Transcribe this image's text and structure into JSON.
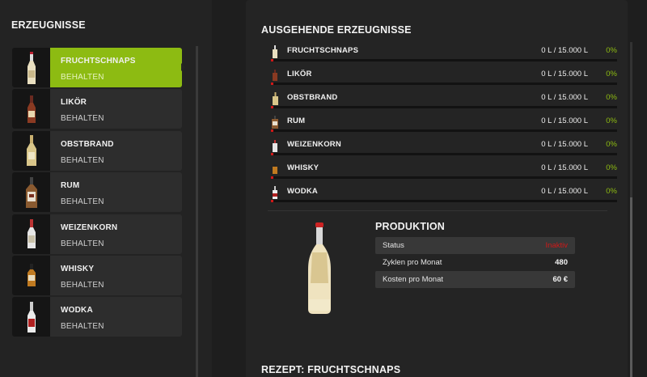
{
  "left": {
    "title": "ERZEUGNISSE",
    "items": [
      {
        "name": "FRUCHTSCHNAPS",
        "sub": "BEHALTEN",
        "active": true,
        "icon": "tall-bottle-icon"
      },
      {
        "name": "LIKÖR",
        "sub": "BEHALTEN",
        "active": false,
        "icon": "liqueur-bottle-icon"
      },
      {
        "name": "OBSTBRAND",
        "sub": "BEHALTEN",
        "active": false,
        "icon": "brandy-bottle-icon"
      },
      {
        "name": "RUM",
        "sub": "BEHALTEN",
        "active": false,
        "icon": "rum-bottle-icon"
      },
      {
        "name": "WEIZENKORN",
        "sub": "BEHALTEN",
        "active": false,
        "icon": "grain-bottle-icon"
      },
      {
        "name": "WHISKY",
        "sub": "BEHALTEN",
        "active": false,
        "icon": "whisky-bottle-icon"
      },
      {
        "name": "WODKA",
        "sub": "BEHALTEN",
        "active": false,
        "icon": "vodka-bottle-icon"
      }
    ]
  },
  "right": {
    "title": "AUSGEHENDE ERZEUGNISSE",
    "outputs": [
      {
        "name": "FRUCHTSCHNAPS",
        "amount": "0 L / 15.000 L",
        "pct": "0%",
        "fill": 0
      },
      {
        "name": "LIKÖR",
        "amount": "0 L / 15.000 L",
        "pct": "0%",
        "fill": 0
      },
      {
        "name": "OBSTBRAND",
        "amount": "0 L / 15.000 L",
        "pct": "0%",
        "fill": 0
      },
      {
        "name": "RUM",
        "amount": "0 L / 15.000 L",
        "pct": "0%",
        "fill": 0
      },
      {
        "name": "WEIZENKORN",
        "amount": "0 L / 15.000 L",
        "pct": "0%",
        "fill": 0
      },
      {
        "name": "WHISKY",
        "amount": "0 L / 15.000 L",
        "pct": "0%",
        "fill": 0
      },
      {
        "name": "WODKA",
        "amount": "0 L / 15.000 L",
        "pct": "0%",
        "fill": 0
      }
    ],
    "production": {
      "title": "PRODUKTION",
      "rows": [
        {
          "label": "Status",
          "value": "Inaktiv"
        },
        {
          "label": "Zyklen pro Monat",
          "value": "480"
        },
        {
          "label": "Kosten pro Monat",
          "value": "60 €"
        }
      ]
    },
    "recipe_title": "REZEPT: FRUCHTSCHNAPS"
  },
  "colors": {
    "accent": "#8dbb12",
    "status_red": "#d01818",
    "background": "#1e1e1e",
    "panel": "#242424"
  }
}
